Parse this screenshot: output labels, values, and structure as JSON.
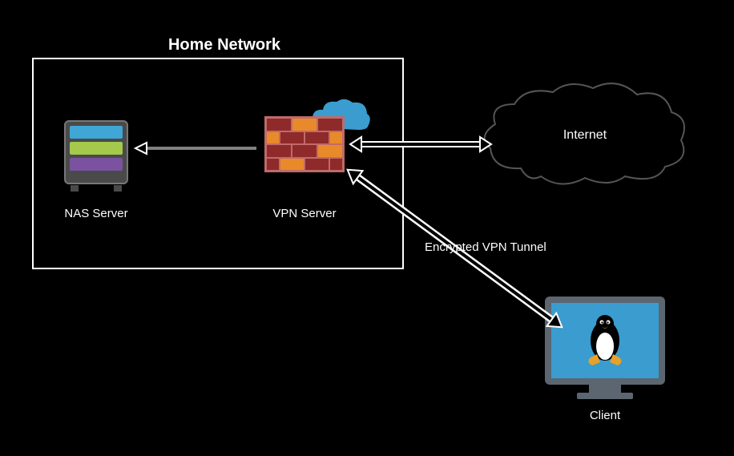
{
  "title": "Home Network",
  "nodes": {
    "nas": {
      "label": "NAS Server"
    },
    "vpn": {
      "label": "VPN Server"
    },
    "internet": {
      "label": "Internet"
    },
    "client": {
      "label": "Client"
    }
  },
  "edges": {
    "vpn_to_nas": {
      "label": ""
    },
    "internet_to_vpn": {
      "label": ""
    },
    "client_to_vpn": {
      "label": "Encrypted VPN Tunnel"
    }
  }
}
